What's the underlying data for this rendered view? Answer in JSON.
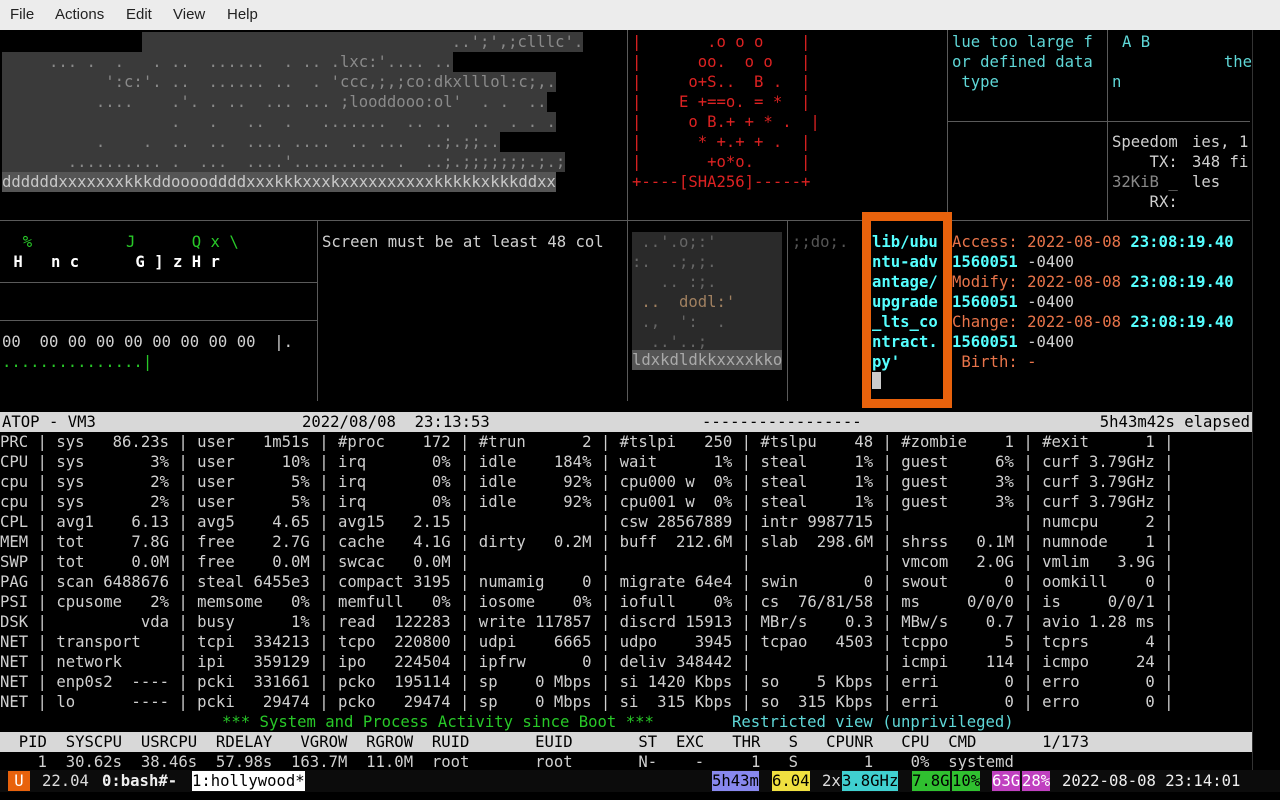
{
  "menu": {
    "file": "File",
    "actions": "Actions",
    "edit": "Edit",
    "view": "View",
    "help": "Help"
  },
  "pane1": {
    "lines": [
      "                                 ..';',;clllc'.",
      "     ... .  .   . ..  ......  . .. .lxc:'.... ..",
      "           ':c:'. ..  ...... ..  . 'ccc,;,;co:dkxlllol:c;,.",
      "          ....    .'. . ..  ... ... ;looddooo:ol'  . .  ..",
      "                  .   .   ..  .   .......  .. ..  ..  . . .",
      "          .    .  ..  ..  .... ....  .. ...  ..;.;;..",
      "       .......... .  ...  ....'.......... .  ..;.;;;;;;;.;.;",
      "ddddddxxxxxxxkkkddooooddddxxxkkkxxxkxxxxxxxxxxkkkkkxkkkddxx"
    ]
  },
  "pane2": {
    "lines": [
      "|       .o o o    |",
      "|      oo.  o o   |",
      "|     o+S..  B .  |",
      "|    E +==o. = *  |",
      "|     o B.+ + * .  |",
      "|      * +.+ + .  |",
      "|       +o*o.     |",
      "+----[SHA256]-----+"
    ]
  },
  "pane3": {
    "lines": [
      "lue too large f",
      "or defined data",
      " type"
    ]
  },
  "pane4": {
    "l1": "A B",
    "l2": "the",
    "l3": "n"
  },
  "pane5": {
    "lines": [
      "Speedom",
      "    TX:",
      "32KiB _",
      "    RX:"
    ],
    "right": [
      "ies, 1",
      "348 fi",
      "les"
    ]
  },
  "pane6": {
    "r1": "  %          J      Q x \\",
    "r2": " H   n c      G ] z H r"
  },
  "pane7": {
    "text": "Screen must be at least 48 col"
  },
  "pane8": {
    "r1": "00  00 00 00 00 00 00 00 00  |.",
    "r2": "...............|"
  },
  "pane9": {
    "lines": [
      " ..'.o;:'",
      ":.  .;,;.",
      "   .. :;.",
      " ..  dodl:'",
      " .,  ':  .",
      "  ..'..;",
      "ldxkdldkkxxxxkko"
    ]
  },
  "pane10": {
    "text": ";;do;."
  },
  "pane11": {
    "lines": [
      "lib/ubu",
      "ntu-adv",
      "antage/",
      "upgrade",
      "_lts_co",
      "ntract.",
      "py'"
    ]
  },
  "pane12": {
    "access_label": "Access:",
    "access_date": "2022-08-08",
    "access_time": "23:08:19.40",
    "frac1": "1560051",
    "tz1": "-0400",
    "modify_label": "Modify:",
    "modify_date": "2022-08-08",
    "modify_time": "23:08:19.40",
    "frac2": "1560051",
    "tz2": "-0400",
    "change_label": "Change:",
    "change_date": "2022-08-08",
    "change_time": "23:08:19.40",
    "frac3": "1560051",
    "tz3": "-0400",
    "birth": " Birth: -"
  },
  "atop": {
    "title": "ATOP - VM3",
    "date": "2022/08/08  23:13:53",
    "dashes": "-----------------",
    "elapsed": "5h43m42s elapsed",
    "rows": [
      "PRC | sys   86.23s | user   1m51s | #proc    172 | #trun      2 | #tslpi   250 | #tslpu    48 | #zombie    1 | #exit      1 |",
      "CPU | sys       3% | user     10% | irq       0% | idle    184% | wait      1% | steal     1% | guest     6% | curf 3.79GHz |",
      "cpu | sys       2% | user      5% | irq       0% | idle     92% | cpu000 w  0% | steal     1% | guest     3% | curf 3.79GHz |",
      "cpu | sys       2% | user      5% | irq       0% | idle     92% | cpu001 w  0% | steal     1% | guest     3% | curf 3.79GHz |",
      "CPL | avg1    6.13 | avg5    4.65 | avg15   2.15 |              | csw 28567889 | intr 9987715 |              | numcpu     2 |",
      "MEM | tot     7.8G | free    2.7G | cache   4.1G | dirty   0.2M | buff  212.6M | slab  298.6M | shrss   0.1M | numnode    1 |",
      "SWP | tot     0.0M | free    0.0M | swcac   0.0M |              |              |              | vmcom   2.0G | vmlim   3.9G |",
      "PAG | scan 6488676 | steal 6455e3 | compact 3195 | numamig    0 | migrate 64e4 | swin       0 | swout      0 | oomkill    0 |",
      "PSI | cpusome   2% | memsome   0% | memfull   0% | iosome    0% | iofull    0% | cs  76/81/58 | ms     0/0/0 | is     0/0/1 |",
      "DSK |          vda | busy      1% | read  122283 | write 117857 | discrd 15913 | MBr/s    0.3 | MBw/s    0.7 | avio 1.28 ms |",
      "NET | transport    | tcpi  334213 | tcpo  220800 | udpi    6665 | udpo    3945 | tcpao   4503 | tcppo      5 | tcprs      4 |",
      "NET | network      | ipi   359129 | ipo   224504 | ipfrw      0 | deliv 348442 |              | icmpi    114 | icmpo     24 |",
      "NET | enp0s2  ---- | pcki  331661 | pcko  195114 | sp    0 Mbps | si 1420 Kbps | so    5 Kbps | erri       0 | erro       0 |",
      "NET | lo      ---- | pcki   29474 | pcko   29474 | sp    0 Mbps | si  315 Kbps | so  315 Kbps | erri       0 | erro       0 |"
    ],
    "activity": "*** System and Process Activity since Boot ***",
    "restricted": "Restricted view (unprivileged)",
    "proc_header": "  PID  SYSCPU  USRCPU  RDELAY   VGROW  RGROW  RUID       EUID       ST  EXC   THR   S   CPUNR   CPU  CMD       1/173",
    "proc_row": "    1  30.62s  38.46s  57.98s  163.7M  11.0M  root       root       N-    -     1   S       1    0%  systemd"
  },
  "tmux": {
    "prefix": "U",
    "load": "22.04",
    "win0": "0:bash#-",
    "win1": "1:hollywood*",
    "uptime": "5h43m",
    "loadavg": "6.04",
    "cpu": "2x",
    "ghz": "3.8GHz",
    "mem": "7.8G",
    "mem_pct": "10%",
    "disk": "63G",
    "disk_pct": "28%",
    "datetime": "2022-08-08 23:14:01"
  },
  "colors": {
    "accent_orange": "#e8620c",
    "term_teal": "#5fd7d7",
    "ascii_red": "#dd2222"
  }
}
